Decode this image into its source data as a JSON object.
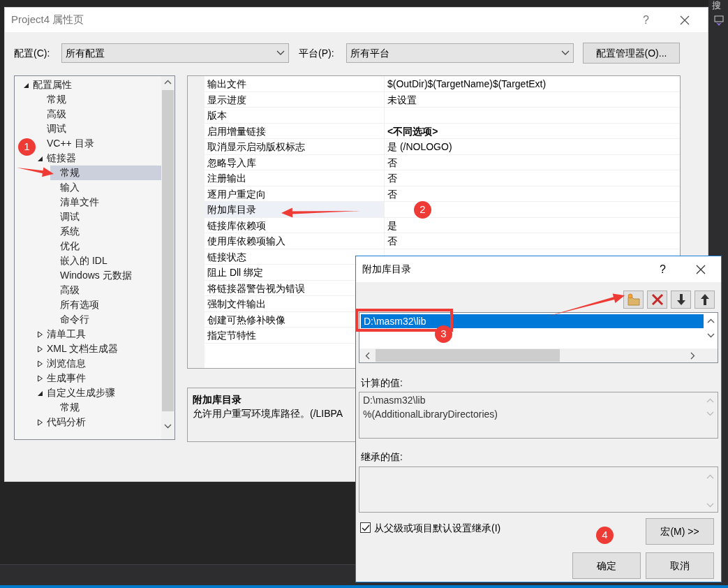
{
  "window": {
    "title": "Project4 属性页",
    "help": "?"
  },
  "config": {
    "label": "配置(C):",
    "value": "所有配置"
  },
  "platform": {
    "label": "平台(P):",
    "value": "所有平台"
  },
  "config_manager_button": "配置管理器(O)...",
  "tree": [
    {
      "label": "配置属性",
      "expanded": true,
      "selected": false,
      "children": [
        {
          "label": "常规",
          "selected": false
        },
        {
          "label": "高级",
          "selected": false
        },
        {
          "label": "调试",
          "selected": false
        },
        {
          "label": "VC++ 目录",
          "selected": false
        },
        {
          "label": "链接器",
          "expanded": true,
          "selected": false,
          "children": [
            {
              "label": "常规",
              "selected": true
            },
            {
              "label": "输入",
              "selected": false
            },
            {
              "label": "清单文件",
              "selected": false
            },
            {
              "label": "调试",
              "selected": false
            },
            {
              "label": "系统",
              "selected": false
            },
            {
              "label": "优化",
              "selected": false
            },
            {
              "label": "嵌入的 IDL",
              "selected": false
            },
            {
              "label": "Windows 元数据",
              "selected": false
            },
            {
              "label": "高级",
              "selected": false
            },
            {
              "label": "所有选项",
              "selected": false
            },
            {
              "label": "命令行",
              "selected": false
            }
          ]
        },
        {
          "label": "清单工具",
          "expanded": false,
          "selected": false
        },
        {
          "label": "XML 文档生成器",
          "expanded": false,
          "selected": false
        },
        {
          "label": "浏览信息",
          "expanded": false,
          "selected": false
        },
        {
          "label": "生成事件",
          "expanded": false,
          "selected": false
        },
        {
          "label": "自定义生成步骤",
          "expanded": true,
          "selected": false,
          "children": [
            {
              "label": "常规",
              "selected": false
            }
          ]
        },
        {
          "label": "代码分析",
          "expanded": false,
          "selected": false
        }
      ]
    }
  ],
  "properties": [
    {
      "name": "输出文件",
      "value": "$(OutDir)$(TargetName)$(TargetExt)",
      "selected": false,
      "bold": false
    },
    {
      "name": "显示进度",
      "value": "未设置",
      "selected": false,
      "bold": false
    },
    {
      "name": "版本",
      "selected": false
    },
    {
      "name": "启用增量链接",
      "value": "<不同选项>",
      "selected": false,
      "bold": true
    },
    {
      "name": "取消显示启动版权标志",
      "value": "是 (/NOLOGO)",
      "selected": false,
      "bold": false
    },
    {
      "name": "忽略导入库",
      "value": "否",
      "selected": false,
      "bold": false
    },
    {
      "name": "注册输出",
      "value": "否",
      "selected": false,
      "bold": false
    },
    {
      "name": "逐用户重定向",
      "value": "否",
      "selected": false,
      "bold": false
    },
    {
      "name": "附加库目录",
      "selected": true
    },
    {
      "name": "链接库依赖项",
      "value": "是",
      "selected": false,
      "bold": false
    },
    {
      "name": "使用库依赖项输入",
      "value": "否",
      "selected": false,
      "bold": false
    },
    {
      "name": "链接状态",
      "selected": false
    },
    {
      "name": "阻止 Dll 绑定",
      "selected": false
    },
    {
      "name": "将链接器警告视为错误",
      "selected": false
    },
    {
      "name": "强制文件输出",
      "selected": false
    },
    {
      "name": "创建可热修补映像",
      "selected": false
    },
    {
      "name": "指定节特性",
      "selected": false
    }
  ],
  "description": {
    "title": "附加库目录",
    "text": "允许用户重写环境库路径。(/LIBPA"
  },
  "dialog": {
    "title": "附加库目录",
    "help": "?",
    "items": [
      {
        "text": "D:\\masm32\\lib",
        "selected": true
      }
    ],
    "evaluated_label": "计算的值:",
    "evaluated_lines": [
      "D:\\masm32\\lib",
      "%(AdditionalLibraryDirectories)"
    ],
    "inherited_label": "继承的值:",
    "inherit": {
      "label": "从父级或项目默认设置继承(I)",
      "checked": true
    },
    "macro_button": "宏(M) >>",
    "ok_button": "确定",
    "cancel_button": "取消"
  },
  "annotations": [
    {
      "number": "1"
    },
    {
      "number": "2"
    },
    {
      "number": "3"
    },
    {
      "number": "4"
    }
  ],
  "background": {
    "search_label": "搜"
  }
}
